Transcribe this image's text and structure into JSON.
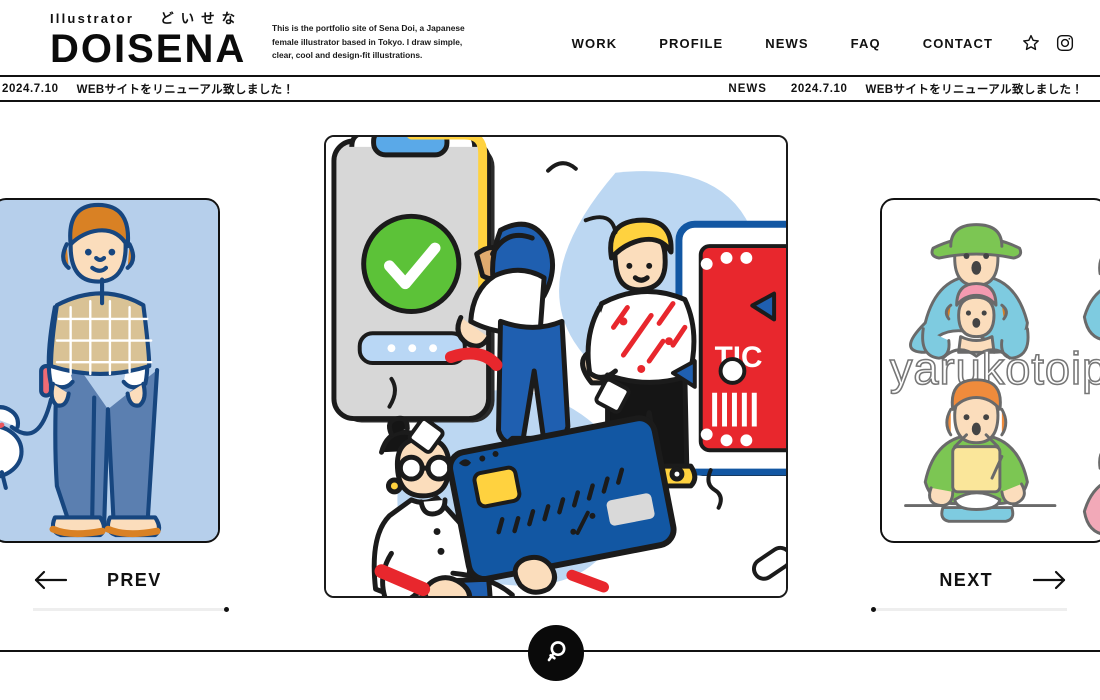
{
  "header": {
    "brand_kicker": "Illustrator",
    "brand_kicker_jp": "どいせな",
    "brand_word": "DOISENA",
    "tagline": "This is the portfolio site of Sena Doi, a Japanese female illustrator based in Tokyo. I draw simple, clear, cool and design-fit illustrations.",
    "nav": [
      {
        "label": "WORK"
      },
      {
        "label": "PROFILE"
      },
      {
        "label": "NEWS"
      },
      {
        "label": "FAQ"
      },
      {
        "label": "CONTACT"
      }
    ],
    "icons": [
      {
        "name": "star-icon"
      },
      {
        "name": "instagram-icon"
      }
    ]
  },
  "ticker": {
    "label": "NEWS",
    "date": "2024.7.10",
    "text": "WEBサイトをリニューアル致しました！",
    "repeat": 3
  },
  "slider": {
    "prev": {
      "label": "PREV",
      "arrow": "arrow-left-icon"
    },
    "next": {
      "label": "NEXT",
      "arrow": "arrow-right-icon"
    },
    "prev_card": {
      "name": "woman-walking-dog-illustration",
      "background": "#b6cfeb"
    },
    "next_card": {
      "name": "yarukotoippai-illustration-set",
      "title_text": "yarukotoip",
      "background": "#ffffff"
    },
    "hero": {
      "name": "mobile-payment-ticket-illustration",
      "ticket_text": "TIC",
      "background": "#ffffff"
    }
  },
  "search": {
    "name": "search-button",
    "icon": "magnifier-icon"
  },
  "colors": {
    "ink": "#111111",
    "pale_blue": "#b6cfeb",
    "blob_blue": "#bcd7f2",
    "brand_blue": "#1565ad",
    "accent_red": "#e8272d",
    "accent_yellow": "#ffcf2e",
    "accent_green": "#5cc238",
    "skin": "#fbddbc",
    "card_grey": "#d7d7d7"
  }
}
